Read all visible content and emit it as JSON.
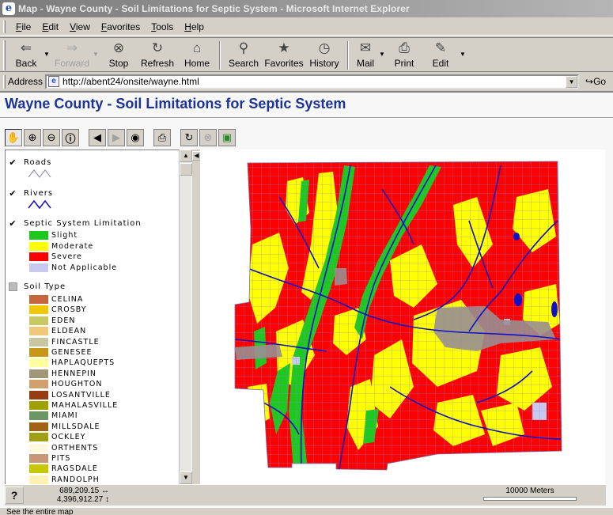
{
  "window": {
    "title": "Map - Wayne County - Soil Limitations for Septic System - Microsoft Internet Explorer"
  },
  "menu": [
    {
      "key": "F",
      "rest": "ile"
    },
    {
      "key": "E",
      "rest": "dit"
    },
    {
      "key": "V",
      "rest": "iew"
    },
    {
      "key": "F",
      "rest": "avorites",
      "prefix": ""
    },
    {
      "key": "T",
      "rest": "ools"
    },
    {
      "key": "H",
      "rest": "elp"
    }
  ],
  "toolbar": {
    "back": "Back",
    "forward": "Forward",
    "stop": "Stop",
    "refresh": "Refresh",
    "home": "Home",
    "search": "Search",
    "favorites": "Favorites",
    "history": "History",
    "mail": "Mail",
    "print": "Print",
    "edit": "Edit"
  },
  "address": {
    "label": "Address",
    "url": "http://abent24/onsite/wayne.html",
    "go": "Go"
  },
  "page": {
    "title": "Wayne County - Soil Limitations for Septic System"
  },
  "legend": {
    "layers": [
      {
        "name": "Roads",
        "checked": true
      },
      {
        "name": "Rivers",
        "checked": true
      },
      {
        "name": "Septic System Limitation",
        "checked": true
      },
      {
        "name": "Soil Type",
        "checked": false
      }
    ],
    "septic": [
      {
        "label": "Slight",
        "color": "#1ec81e"
      },
      {
        "label": "Moderate",
        "color": "#ffff00"
      },
      {
        "label": "Severe",
        "color": "#ff0000"
      },
      {
        "label": "Not Applicable",
        "color": "#c8c8f0"
      }
    ],
    "soils": [
      {
        "label": "CELINA",
        "color": "#c8643c"
      },
      {
        "label": "CROSBY",
        "color": "#f0c800"
      },
      {
        "label": "EDEN",
        "color": "#c8c864"
      },
      {
        "label": "ELDEAN",
        "color": "#f0c87c"
      },
      {
        "label": "FINCASTLE",
        "color": "#c8c8a0"
      },
      {
        "label": "GENESEE",
        "color": "#c89614"
      },
      {
        "label": "HAPLAQUEPTS",
        "color": "#ffffa0"
      },
      {
        "label": "HENNEPIN",
        "color": "#a09678"
      },
      {
        "label": "HOUGHTON",
        "color": "#d2a06e"
      },
      {
        "label": "LOSANTVILLE",
        "color": "#963c14"
      },
      {
        "label": "MAHALASVILLE",
        "color": "#a0a000"
      },
      {
        "label": "MIAMI",
        "color": "#6e9664"
      },
      {
        "label": "MILLSDALE",
        "color": "#a06414"
      },
      {
        "label": "OCKLEY",
        "color": "#a0a014"
      },
      {
        "label": "ORTHENTS",
        "color": "#fff8dc"
      },
      {
        "label": "PITS",
        "color": "#c89678"
      },
      {
        "label": "RAGSDALE",
        "color": "#c8c800"
      },
      {
        "label": "RANDOLPH",
        "color": "#fff0b4"
      }
    ]
  },
  "status": {
    "help": "?",
    "x_coord": "689,209.15 ↔",
    "y_coord": "4,396,912.27 ↕",
    "scale": "10000 Meters",
    "browser_status": "See the entire map"
  }
}
